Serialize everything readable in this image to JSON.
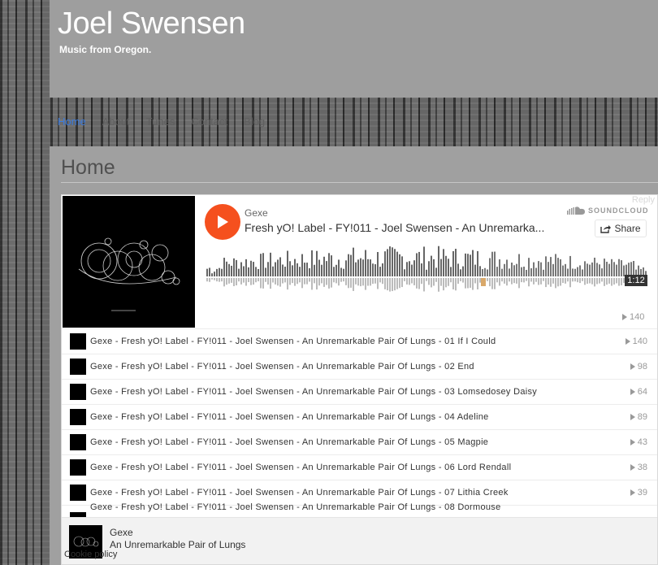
{
  "site": {
    "title": "Joel Swensen",
    "description": "Music from Oregon."
  },
  "nav": {
    "items": [
      {
        "label": "Home",
        "active": true
      },
      {
        "label": "About",
        "active": false
      },
      {
        "label": "Tunes",
        "active": false
      },
      {
        "label": "Contact",
        "active": false
      },
      {
        "label": "Blog",
        "active": false
      }
    ]
  },
  "page": {
    "title": "Home",
    "reply_label": "Reply"
  },
  "player": {
    "user": "Gexe",
    "track_title": "Fresh yO! Label - FY!011 - Joel Swensen - An Unremarka...",
    "logo_text": "SOUNDCLOUD",
    "share_label": "Share",
    "elapsed": "1:12",
    "plays": "140",
    "tracks": [
      {
        "title": "Gexe - Fresh yO! Label - FY!011 - Joel Swensen - An Unremarkable Pair Of Lungs - 01 If I Could",
        "plays": "140"
      },
      {
        "title": "Gexe - Fresh yO! Label - FY!011 - Joel Swensen - An Unremarkable Pair Of Lungs - 02 End",
        "plays": "98"
      },
      {
        "title": "Gexe - Fresh yO! Label - FY!011 - Joel Swensen - An Unremarkable Pair Of Lungs - 03 Lomsedosey Daisy",
        "plays": "64"
      },
      {
        "title": "Gexe - Fresh yO! Label - FY!011 - Joel Swensen - An Unremarkable Pair Of Lungs - 04 Adeline",
        "plays": "89"
      },
      {
        "title": "Gexe - Fresh yO! Label - FY!011 - Joel Swensen - An Unremarkable Pair Of Lungs - 05 Magpie",
        "plays": "43"
      },
      {
        "title": "Gexe - Fresh yO! Label - FY!011 - Joel Swensen - An Unremarkable Pair Of Lungs - 06 Lord Rendall",
        "plays": "38"
      },
      {
        "title": "Gexe - Fresh yO! Label - FY!011 - Joel Swensen - An Unremarkable Pair Of Lungs - 07 Lithia Creek",
        "plays": "39"
      },
      {
        "title": "Gexe - Fresh yO! Label - FY!011 - Joel Swensen - An Unremarkable Pair Of Lungs - 08 Dormouse",
        "plays": ""
      }
    ],
    "footer": {
      "user": "Gexe",
      "album": "An Unremarkable Pair of Lungs"
    }
  },
  "cookie": {
    "label": "Cookie policy"
  },
  "colors": {
    "accent": "#f5501e",
    "nav_active": "#3a7be0",
    "header_bg": "#9e9e9e",
    "content_bg": "#a0a0a0"
  },
  "icons": {
    "play": "play-icon",
    "share": "share-icon",
    "soundcloud": "soundcloud-cloud-icon",
    "plays": "play-count-icon"
  }
}
